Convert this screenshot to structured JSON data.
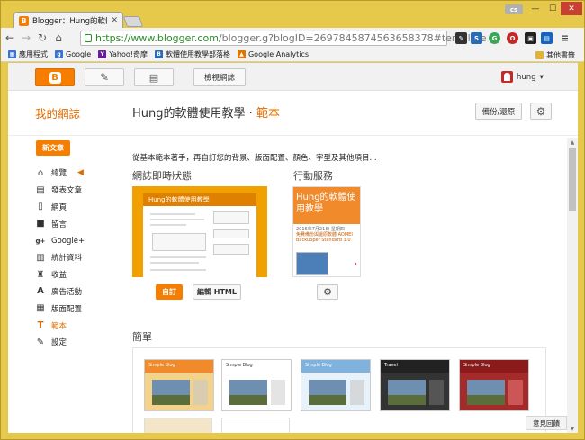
{
  "browser": {
    "tab_title": "Blogger：Hung的軟體使",
    "tab_favicon": "B",
    "user_badge": "cs",
    "url_host": "https://www.blogger.com",
    "url_path": "/blogger.g?blogID=2697845874563658378#template",
    "bookmarks": [
      {
        "label": "應用程式",
        "icon": "apps-icon",
        "color": "#3b73d1"
      },
      {
        "label": "Google",
        "icon": "google-icon",
        "color": "#3b73d1"
      },
      {
        "label": "Yahoo!奇摩",
        "icon": "yahoo-icon",
        "color": "#6a1b9a"
      },
      {
        "label": "軟體使用教學部落格",
        "icon": "blogger-icon",
        "color": "#f57d00"
      },
      {
        "label": "Google Analytics",
        "icon": "analytics-icon",
        "color": "#e37400"
      }
    ],
    "other_bookmarks": "其他書籤"
  },
  "blogger": {
    "view_blog": "檢視網誌",
    "username": "hung",
    "my_blogs": "我的網誌",
    "blog_title": "Hung的軟體使用教學",
    "separator": "·",
    "section": "範本",
    "backup_restore": "備份/還原",
    "new_post": "新文章",
    "nav": [
      {
        "label": "總覽",
        "icon": "home-icon",
        "glyph": "⌂"
      },
      {
        "label": "發表文章",
        "icon": "posts-icon",
        "glyph": "▤"
      },
      {
        "label": "網頁",
        "icon": "pages-icon",
        "glyph": "▯"
      },
      {
        "label": "留言",
        "icon": "comments-icon",
        "glyph": "■"
      },
      {
        "label": "Google+",
        "icon": "google-plus-icon",
        "glyph": "g+"
      },
      {
        "label": "統計資料",
        "icon": "stats-icon",
        "glyph": "▥"
      },
      {
        "label": "收益",
        "icon": "earnings-icon",
        "glyph": "♜"
      },
      {
        "label": "廣告活動",
        "icon": "campaigns-icon",
        "glyph": "A"
      },
      {
        "label": "版面配置",
        "icon": "layout-icon",
        "glyph": "▦"
      },
      {
        "label": "範本",
        "icon": "template-icon",
        "glyph": "T",
        "active": true
      },
      {
        "label": "設定",
        "icon": "settings-wrench-icon",
        "glyph": "✎"
      }
    ],
    "intro": "從基本範本著手，再自訂您的背景、版面配置、顏色、字型及其他項目...",
    "live_heading": "網誌即時狀態",
    "mobile_heading": "行動服務",
    "live_preview_title": "Hung的軟體使用教學",
    "mobile_preview_title": "Hung的軟體使用教學",
    "mobile_preview_date": "2016年7月21日 星期四",
    "mobile_preview_post": "免費備份與還原軟體 AOMEI Backupper Standard 3.0",
    "customize": "自訂",
    "edit_html": "編輯 HTML",
    "simple_heading": "簡單",
    "gallery": [
      {
        "name": "Simple Blog",
        "head": "#f08a2a",
        "bg": "#f4d28a"
      },
      {
        "name": "Simple Blog",
        "head": "#ffffff",
        "bg": "#ffffff"
      },
      {
        "name": "Simple Blog",
        "head": "#7fb2dc",
        "bg": "#e8f2fa"
      },
      {
        "name": "Travel",
        "head": "#222222",
        "bg": "#333333"
      },
      {
        "name": "Simple Blog",
        "head": "#8b1a1a",
        "bg": "#a52a2a"
      }
    ],
    "feedback": "意見回饋"
  }
}
